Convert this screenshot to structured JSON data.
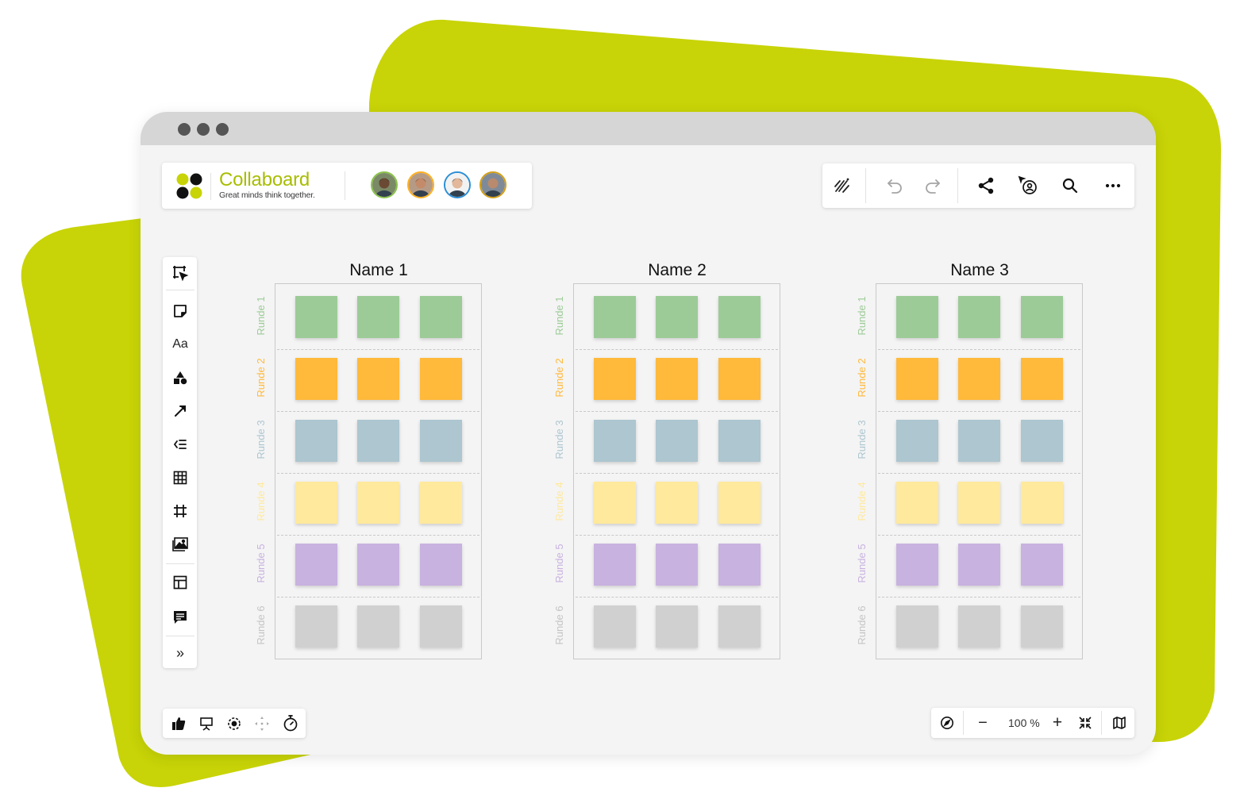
{
  "brand": {
    "name": "Collaboard",
    "tagline": "Great minds think together.",
    "accent": "#c8d407"
  },
  "collaborators": [
    {
      "name": "user-1",
      "ring": "#8bc34a"
    },
    {
      "name": "user-2",
      "ring": "#ffb020"
    },
    {
      "name": "user-3",
      "ring": "#2a8fd6"
    },
    {
      "name": "user-4",
      "ring": "#d4a017"
    }
  ],
  "toolbar_right": [
    "pen-wand-icon",
    "undo-icon",
    "redo-icon",
    "share-icon",
    "follow-user-icon",
    "search-icon",
    "more-icon"
  ],
  "sidebar_tools": [
    "select-area-icon",
    "sticky-note-icon",
    "text-icon",
    "shapes-icon",
    "connector-icon",
    "list-icon",
    "table-icon",
    "frame-icon",
    "image-icon",
    "template-icon",
    "comment-icon",
    "expand-icon"
  ],
  "text_tool_label": "Aa",
  "expand_label": "»",
  "board": {
    "columns": [
      "Name 1",
      "Name 2",
      "Name 3"
    ],
    "rounds": [
      {
        "label": "Runde 1",
        "color": "#9ccb97",
        "text_color": "#9ccb97"
      },
      {
        "label": "Runde 2",
        "color": "#ffb93b",
        "text_color": "#ffb93b"
      },
      {
        "label": "Runde 3",
        "color": "#adc6d0",
        "text_color": "#adc6d0"
      },
      {
        "label": "Runde 4",
        "color": "#ffe99c",
        "text_color": "#ffe99c"
      },
      {
        "label": "Runde 5",
        "color": "#c8b2e0",
        "text_color": "#c8b2e0"
      },
      {
        "label": "Runde 6",
        "color": "#d0d0d0",
        "text_color": "#c4c4c4"
      }
    ],
    "notes_per_round": 3
  },
  "bottom_left_tools": [
    "thumbs-up-icon",
    "presentation-icon",
    "focus-icon",
    "navigate-icon",
    "timer-icon"
  ],
  "zoom": {
    "value": "100 %",
    "minus": "−",
    "plus": "+"
  }
}
